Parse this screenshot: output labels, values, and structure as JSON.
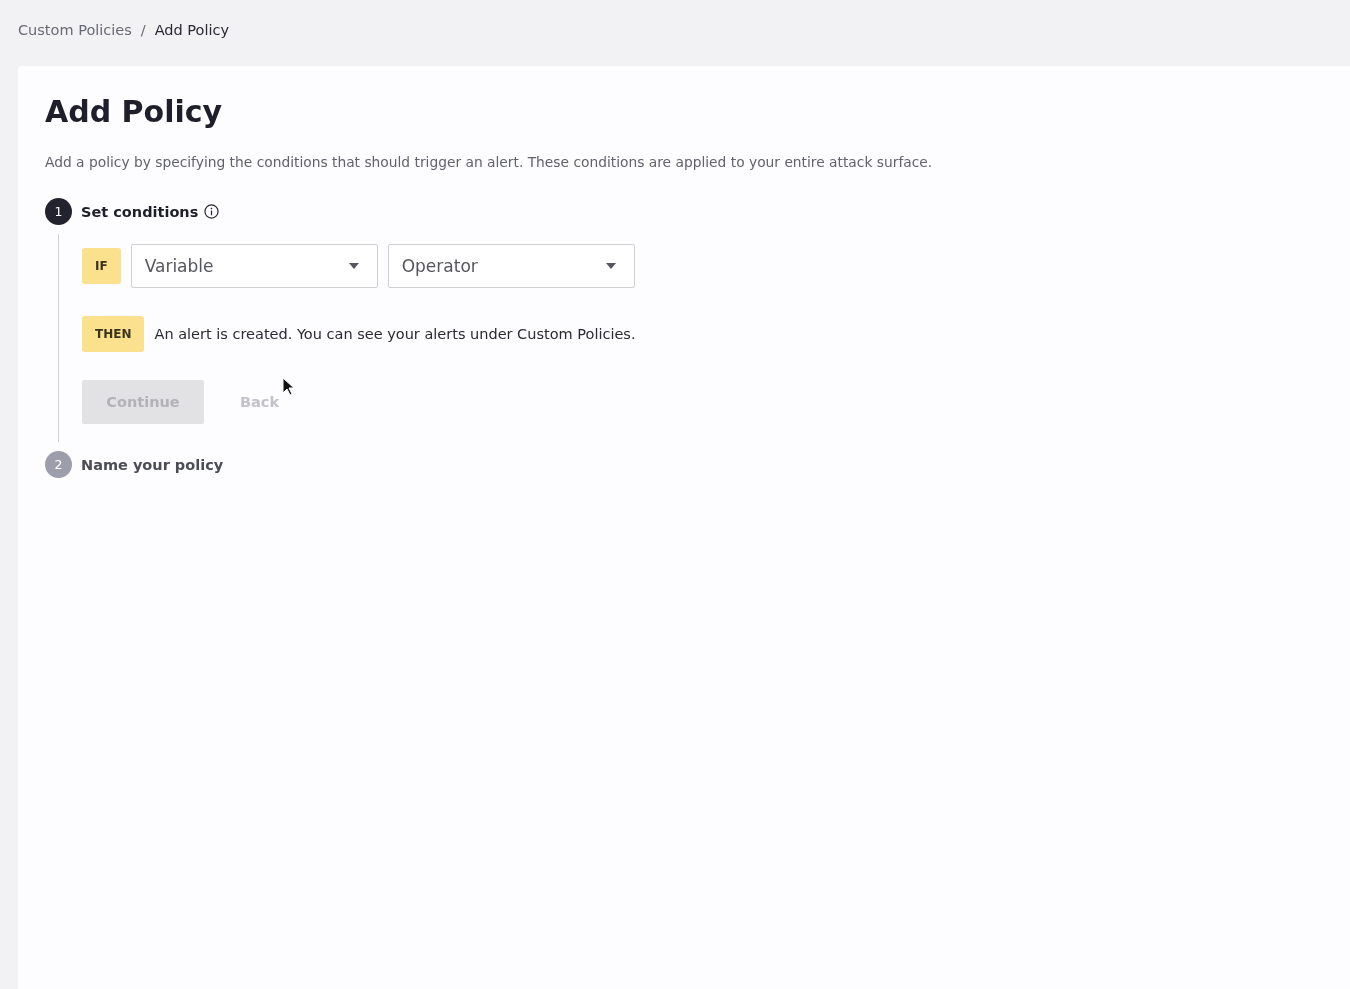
{
  "breadcrumb": {
    "separator": "/",
    "items": [
      {
        "label": "Custom Policies",
        "current": false
      },
      {
        "label": "Add Policy",
        "current": true
      }
    ]
  },
  "page": {
    "title": "Add Policy",
    "description": "Add a policy by specifying the conditions that should trigger an alert. These conditions are applied to your entire attack surface."
  },
  "steps": [
    {
      "number": "1",
      "title": "Set conditions",
      "active": true,
      "info": true,
      "if_label": "IF",
      "selects": [
        {
          "placeholder": "Variable"
        },
        {
          "placeholder": "Operator"
        }
      ],
      "then_label": "THEN",
      "then_text": "An alert is created. You can see your alerts under Custom Policies.",
      "buttons": [
        {
          "label": "Continue",
          "kind": "primary",
          "disabled": true
        },
        {
          "label": "Back",
          "kind": "text",
          "disabled": true
        }
      ]
    },
    {
      "number": "2",
      "title": "Name your policy",
      "active": false
    }
  ]
}
